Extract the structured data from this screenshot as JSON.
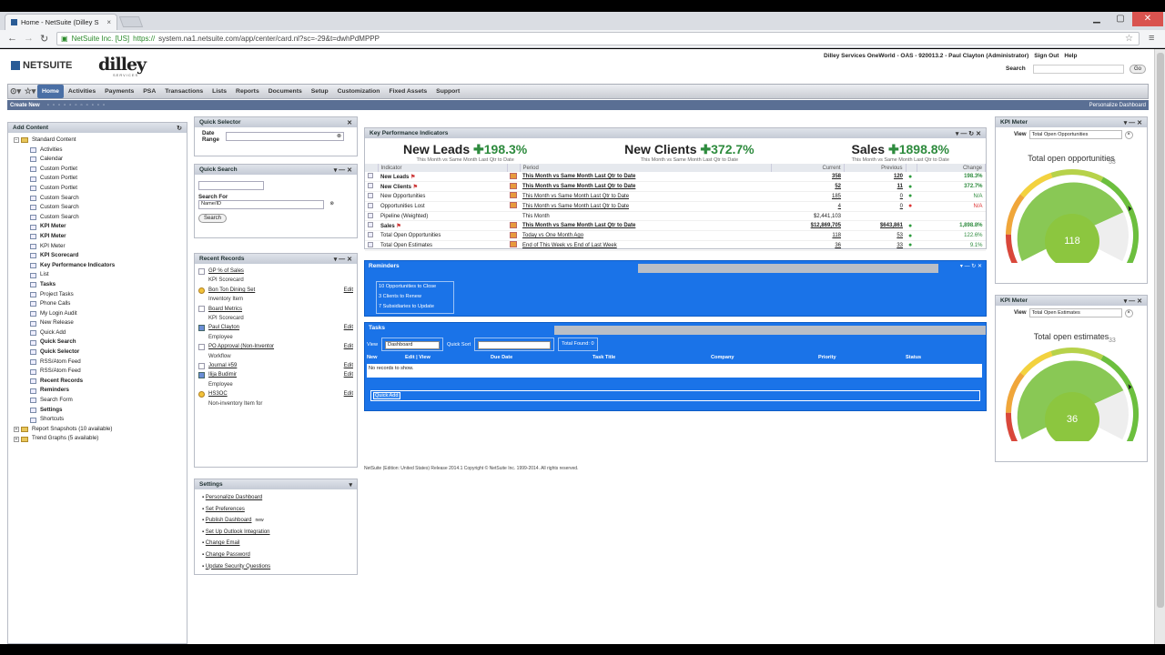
{
  "browser": {
    "tab_title": "Home - NetSuite (Dilley S",
    "tab_close": "×",
    "url_secure": "NetSuite Inc. [US]",
    "url_https": "https://",
    "url_rest": "system.na1.netsuite.com/app/center/card.nl?sc=-29&t=dwhPdMPPP",
    "win_min": "▁",
    "win_max": "▢",
    "win_close": "✕"
  },
  "header": {
    "netsuite_logo": "NETSUITE",
    "dilley_logo": "dilley",
    "dilley_sub": "SERVICES",
    "company": "Dilley Services OneWorld - OAS - 920013.2 - Paul Clayton (Administrator)",
    "sign_out": "Sign Out",
    "help": "Help",
    "search_label": "Search",
    "go": "Go"
  },
  "menu": [
    "Home",
    "Activities",
    "Payments",
    "PSA",
    "Transactions",
    "Lists",
    "Reports",
    "Documents",
    "Setup",
    "Customization",
    "Fixed Assets",
    "Support"
  ],
  "create_bar": {
    "create_new": "Create New",
    "personalize": "Personalize Dashboard"
  },
  "add_content": {
    "title": "Add Content",
    "root": "Standard Content",
    "items": [
      {
        "label": "Activities",
        "bold": false
      },
      {
        "label": "Calendar",
        "bold": false
      },
      {
        "label": "Custom Portlet",
        "bold": false
      },
      {
        "label": "Custom Portlet",
        "bold": false
      },
      {
        "label": "Custom Portlet",
        "bold": false
      },
      {
        "label": "Custom Search",
        "bold": false
      },
      {
        "label": "Custom Search",
        "bold": false
      },
      {
        "label": "Custom Search",
        "bold": false
      },
      {
        "label": "KPI Meter",
        "bold": true
      },
      {
        "label": "KPI Meter",
        "bold": true
      },
      {
        "label": "KPI Meter",
        "bold": false
      },
      {
        "label": "KPI Scorecard",
        "bold": true
      },
      {
        "label": "Key Performance Indicators",
        "bold": true
      },
      {
        "label": "List",
        "bold": false
      },
      {
        "label": "Tasks",
        "bold": true
      },
      {
        "label": "Project Tasks",
        "bold": false
      },
      {
        "label": "Phone Calls",
        "bold": false
      },
      {
        "label": "My Login Audit",
        "bold": false
      },
      {
        "label": "New Release",
        "bold": false
      },
      {
        "label": "Quick Add",
        "bold": false
      },
      {
        "label": "Quick Search",
        "bold": true
      },
      {
        "label": "Quick Selector",
        "bold": true
      },
      {
        "label": "RSS/Atom Feed",
        "bold": false
      },
      {
        "label": "RSS/Atom Feed",
        "bold": false
      },
      {
        "label": "Recent Records",
        "bold": true
      },
      {
        "label": "Reminders",
        "bold": true
      },
      {
        "label": "Search Form",
        "bold": false
      },
      {
        "label": "Settings",
        "bold": true
      },
      {
        "label": "Shortcuts",
        "bold": false
      }
    ],
    "report_snapshots": "Report Snapshots (10 available)",
    "trend_graphs": "Trend Graphs (5 available)"
  },
  "quick_selector": {
    "title": "Quick Selector",
    "date_range": "Date Range"
  },
  "quick_search": {
    "title": "Quick Search",
    "search_for": "Search For",
    "select_value": "Name/ID",
    "button": "Search"
  },
  "recent_records": {
    "title": "Recent Records",
    "edit": "Edit",
    "rows": [
      {
        "name": "GP % of Sales",
        "type": "KPI Scorecard",
        "icon": "doc",
        "edit": false
      },
      {
        "name": "Bon Ton Dining Set",
        "type": "Inventory Item",
        "icon": "y",
        "edit": true
      },
      {
        "name": "Board Metrics",
        "type": "KPI Scorecard",
        "icon": "doc",
        "edit": false
      },
      {
        "name": "Paul Clayton",
        "type": "Employee",
        "icon": "p",
        "edit": true
      },
      {
        "name": "PO Approval (Non-Inventor",
        "type": "Workflow",
        "icon": "doc",
        "edit": true
      },
      {
        "name": "Journal #59",
        "type": "",
        "icon": "doc",
        "edit": true
      },
      {
        "name": "Ilija Budimir",
        "type": "Employee",
        "icon": "p",
        "edit": true
      },
      {
        "name": "HS3OC",
        "type": "Non-inventory Item for",
        "icon": "y",
        "edit": true
      }
    ]
  },
  "settings": {
    "title": "Settings",
    "items": [
      "Personalize Dashboard",
      "Set Preferences",
      "Publish Dashboard",
      "Set Up Outlook Integration",
      "Change Email",
      "Change Password",
      "Update Security Questions"
    ],
    "new_tag": "new"
  },
  "kpi": {
    "title": "Key Performance Indicators",
    "headlines": [
      {
        "label": "New Leads",
        "pct": "198.3%",
        "sub": "This Month vs Same Month Last Qtr to Date"
      },
      {
        "label": "New Clients",
        "pct": "372.7%",
        "sub": "This Month vs Same Month Last Qtr to Date"
      },
      {
        "label": "Sales",
        "pct": "1898.8%",
        "sub": "This Month vs Same Month Last Qtr to Date"
      }
    ],
    "columns": [
      "Indicator",
      "Period",
      "Current",
      "Previous",
      "Change"
    ],
    "rows": [
      {
        "ind": "New Leads",
        "period": "This Month vs Same Month Last Qtr to Date",
        "cur": "358",
        "prev": "120",
        "chg": "198.3%",
        "dot": "g",
        "bold": true
      },
      {
        "ind": "New Clients",
        "period": "This Month vs Same Month Last Qtr to Date",
        "cur": "52",
        "prev": "11",
        "chg": "372.7%",
        "dot": "g",
        "bold": true
      },
      {
        "ind": "New Opportunities",
        "period": "This Month vs Same Month Last Qtr to Date",
        "cur": "185",
        "prev": "0",
        "chg": "N/A",
        "dot": "g",
        "bold": false
      },
      {
        "ind": "Opportunities Lost",
        "period": "This Month vs Same Month Last Qtr to Date",
        "cur": "4",
        "prev": "0",
        "chg": "N/A",
        "dot": "r",
        "bold": false
      },
      {
        "ind": "Pipeline (Weighted)",
        "period": "This Month",
        "cur": "$2,441,103",
        "prev": "",
        "chg": "",
        "dot": "",
        "bold": false
      },
      {
        "ind": "Sales",
        "period": "This Month vs Same Month Last Qtr to Date",
        "cur": "$12,869,705",
        "prev": "$643,861",
        "chg": "1,898.8%",
        "dot": "g",
        "bold": true
      },
      {
        "ind": "Total Open Opportunities",
        "period": "Today vs One Month Ago",
        "cur": "118",
        "prev": "53",
        "chg": "122.6%",
        "dot": "g",
        "bold": false
      },
      {
        "ind": "Total Open Estimates",
        "period": "End of This Week vs End of Last Week",
        "cur": "36",
        "prev": "33",
        "chg": "9.1%",
        "dot": "g",
        "bold": false
      }
    ]
  },
  "reminders": {
    "title": "Reminders",
    "items": [
      "10 Opportunities to Close",
      "3 Clients to Renew",
      "7 Subsidiaries to Update"
    ]
  },
  "tasks": {
    "title": "Tasks",
    "view_label": "View",
    "view_value": "Dashboard",
    "quick_sort": "Quick Sort",
    "total_found": "Total Found: 0",
    "columns": [
      "New",
      "Edit | View",
      "Due Date",
      "Task Title",
      "Company",
      "Priority",
      "Status"
    ],
    "none": "No records to show.",
    "quick_add": "Quick Add"
  },
  "footer": "NetSuite (Edition: United States) Release 2014.1 Copyright © NetSuite Inc. 1999-2014. All rights reserved.",
  "meters": [
    {
      "title": "KPI Meter",
      "view_label": "View",
      "view_value": "Total Open Opportunities",
      "gauge_title": "Total open opportunities",
      "value": "118",
      "max": "53",
      "fraction": 1.0
    },
    {
      "title": "KPI Meter",
      "view_label": "View",
      "view_value": "Total Open Estimates",
      "gauge_title": "Total open estimates",
      "value": "36",
      "max": "33",
      "fraction": 1.0
    }
  ]
}
